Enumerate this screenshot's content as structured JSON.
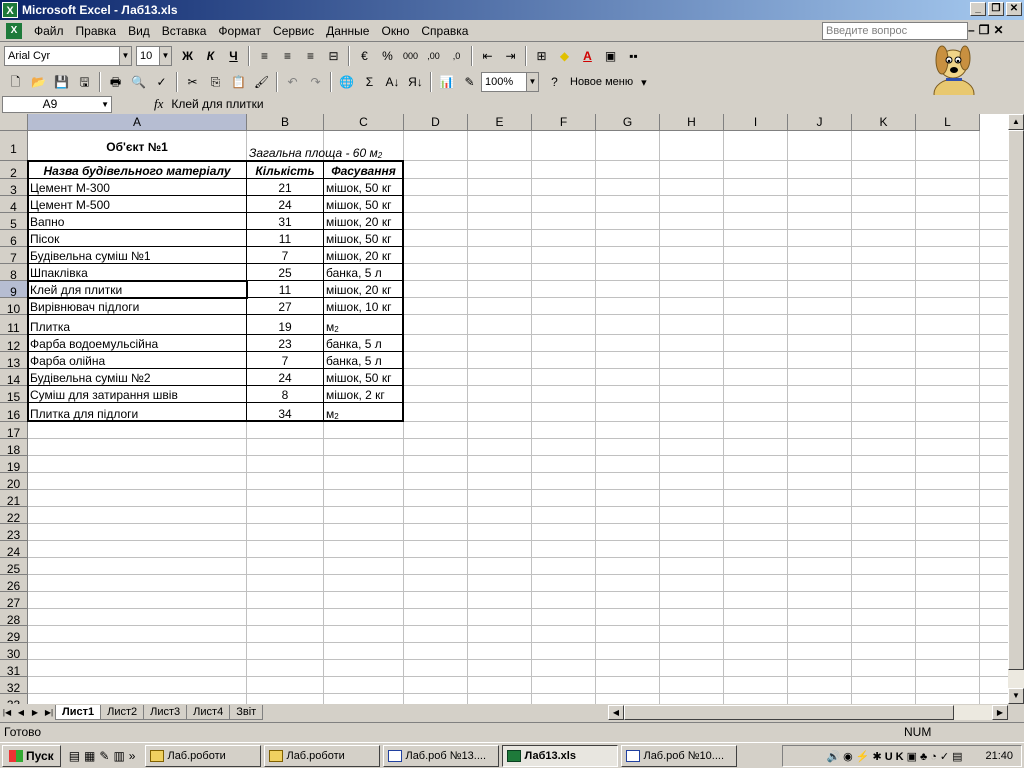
{
  "window": {
    "title": "Microsoft Excel - Лаб13.xls",
    "icon": "excel-icon"
  },
  "menu": [
    "Файл",
    "Правка",
    "Вид",
    "Вставка",
    "Формат",
    "Сервис",
    "Данные",
    "Окно",
    "Справка"
  ],
  "ask_placeholder": "Введите вопрос",
  "toolbar": {
    "font": "Arial Cyr",
    "font_size": "10",
    "bold_label": "Ж",
    "italic_label": "К",
    "underline_label": "Ч",
    "zoom": "100%",
    "new_menu": "Новое меню"
  },
  "formula_bar": {
    "name_box": "A9",
    "fx": "fx",
    "content": "Клей для плитки"
  },
  "columns": [
    "A",
    "B",
    "C",
    "D",
    "E",
    "F",
    "G",
    "H",
    "I",
    "J",
    "K",
    "L"
  ],
  "rows": [
    "1",
    "2",
    "3",
    "4",
    "5",
    "6",
    "7",
    "8",
    "9",
    "10",
    "11",
    "12",
    "13",
    "14",
    "15",
    "16",
    "17",
    "18",
    "19",
    "20",
    "21",
    "22",
    "23",
    "24",
    "25",
    "26",
    "27",
    "28",
    "29",
    "30",
    "31",
    "32",
    "33"
  ],
  "sheet": {
    "title": "Об'єкт №1",
    "area_label": "Загальна площа - 60 м",
    "area_sup": "2",
    "headers": [
      "Назва будівельного матеріалу",
      "Кількість",
      "Фасування"
    ],
    "items": [
      {
        "name": "Цемент М-300",
        "qty": "21",
        "pack": "мішок, 50 кг"
      },
      {
        "name": "Цемент М-500",
        "qty": "24",
        "pack": "мішок, 50 кг"
      },
      {
        "name": "Вапно",
        "qty": "31",
        "pack": "мішок, 20 кг"
      },
      {
        "name": "Пісок",
        "qty": "11",
        "pack": "мішок, 50 кг"
      },
      {
        "name": "Будівельна суміш №1",
        "qty": "7",
        "pack": "мішок, 20 кг"
      },
      {
        "name": "Шпаклівка",
        "qty": "25",
        "pack": "банка, 5 л"
      },
      {
        "name": "Клей для плитки",
        "qty": "11",
        "pack": "мішок, 20 кг"
      },
      {
        "name": "Вирівнювач підлоги",
        "qty": "27",
        "pack": "мішок, 10 кг"
      },
      {
        "name": "Плитка",
        "qty": "19",
        "pack": "м",
        "sup": "2"
      },
      {
        "name": "Фарба водоемульсійна",
        "qty": "23",
        "pack": "банка, 5 л"
      },
      {
        "name": "Фарба олійна",
        "qty": "7",
        "pack": "банка, 5 л"
      },
      {
        "name": "Будівельна суміш №2",
        "qty": "24",
        "pack": "мішок, 50 кг"
      },
      {
        "name": "Суміш для затирання швів",
        "qty": "8",
        "pack": "мішок, 2 кг"
      },
      {
        "name": "Плитка для підлоги",
        "qty": "34",
        "pack": "м",
        "sup": "2"
      }
    ]
  },
  "sheet_tabs": [
    "Лист1",
    "Лист2",
    "Лист3",
    "Лист4",
    "Звіт"
  ],
  "status": {
    "text": "Готово",
    "num": "NUM"
  },
  "taskbar": {
    "start": "Пуск",
    "buttons": [
      {
        "label": "Лаб.роботи",
        "icon": "folder-icon"
      },
      {
        "label": "Лаб.роботи",
        "icon": "folder-icon"
      },
      {
        "label": "Лаб.роб №13....",
        "icon": "word-icon"
      },
      {
        "label": "Лаб13.xls",
        "icon": "excel-icon",
        "active": true
      },
      {
        "label": "Лаб.роб №10....",
        "icon": "word-icon"
      }
    ],
    "clock": "21:40",
    "lang": "UK"
  }
}
